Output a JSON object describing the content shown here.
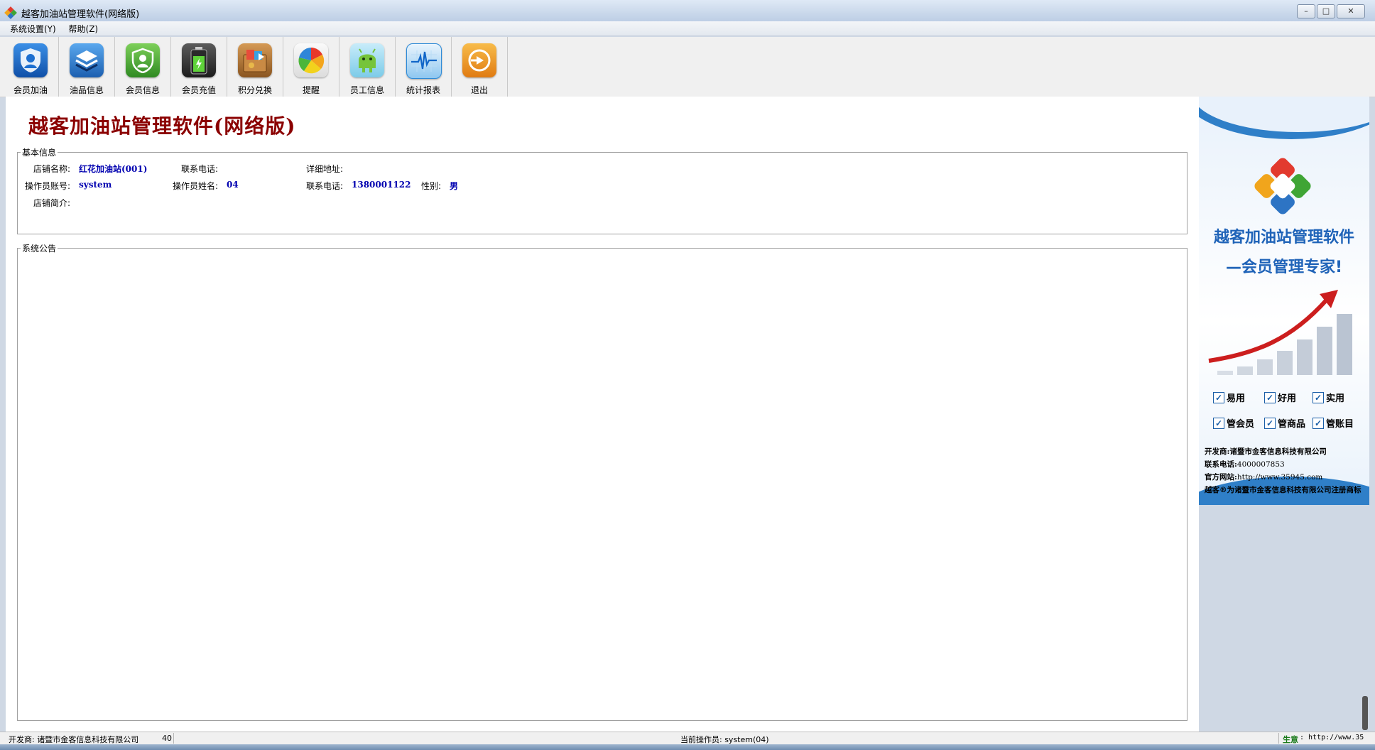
{
  "window": {
    "title": "越客加油站管理软件(网络版)",
    "controls": [
      "minimize",
      "maximize",
      "close"
    ]
  },
  "menu": {
    "items": [
      "系统设置(Y)",
      "帮助(Z)"
    ]
  },
  "toolbar": {
    "buttons": [
      {
        "label": "会员加油",
        "icon": "shield-user-icon",
        "color": "#1d6fd0"
      },
      {
        "label": "油品信息",
        "icon": "layers-icon",
        "color": "#2a7bc8"
      },
      {
        "label": "会员信息",
        "icon": "member-badge-icon",
        "color": "#4caa3a"
      },
      {
        "label": "会员充值",
        "icon": "battery-icon",
        "color": "#3a8a2a"
      },
      {
        "label": "积分兑换",
        "icon": "gift-box-icon",
        "color": "#b8752c"
      },
      {
        "label": "提醒",
        "icon": "colorful-circle-icon",
        "color": "#e85a2a"
      },
      {
        "label": "员工信息",
        "icon": "android-icon",
        "color": "#6ac23a"
      },
      {
        "label": "统计报表",
        "icon": "pulse-chart-icon",
        "color": "#2c8ad8"
      },
      {
        "label": "退出",
        "icon": "exit-icon",
        "color": "#e89a1c"
      }
    ]
  },
  "main": {
    "app_title": "越客加油站管理软件(网络版)",
    "basic_info": {
      "legend": "基本信息",
      "store_name_label": "店铺名称:",
      "store_name_value": "红花加油站(001)",
      "phone_label": "联系电话:",
      "phone_value": "",
      "address_label": "详细地址:",
      "address_value": "",
      "operator_account_label": "操作员账号:",
      "operator_account_value": "system",
      "operator_name_label": "操作员姓名:",
      "operator_name_value": "04",
      "operator_phone_label": "联系电话:",
      "operator_phone_value": "1380001122",
      "gender_label": "性别:",
      "gender_value": "男",
      "intro_label": "店铺简介:",
      "intro_value": ""
    },
    "notice": {
      "legend": "系统公告",
      "content": ""
    }
  },
  "banner": {
    "title_line1": "越客加油站管理软件",
    "title_line2": "—会员管理专家!",
    "checks_row1": [
      "易用",
      "好用",
      "实用"
    ],
    "checks_row2": [
      "管会员",
      "管商品",
      "管账目"
    ],
    "developer_label": "开发商:",
    "developer_value": "诸暨市金客信息科技有限公司",
    "phone_label": "联系电话:",
    "phone_value": "4000007853",
    "site_label": "官方网站:",
    "site_value": "http://www.35945.com",
    "trademark": "越客®为诸暨市金客信息科技有限公司注册商标"
  },
  "statusbar": {
    "developer": "开发商: 诸暨市金客信息科技有限公司",
    "num": "40",
    "current_operator": "当前操作员: system(04)",
    "right_label": "生意",
    "right_url": ": http://www.35"
  },
  "colors": {
    "title_red": "#8b0000",
    "value_blue": "#0000b0",
    "banner_blue": "#1f63b8"
  }
}
